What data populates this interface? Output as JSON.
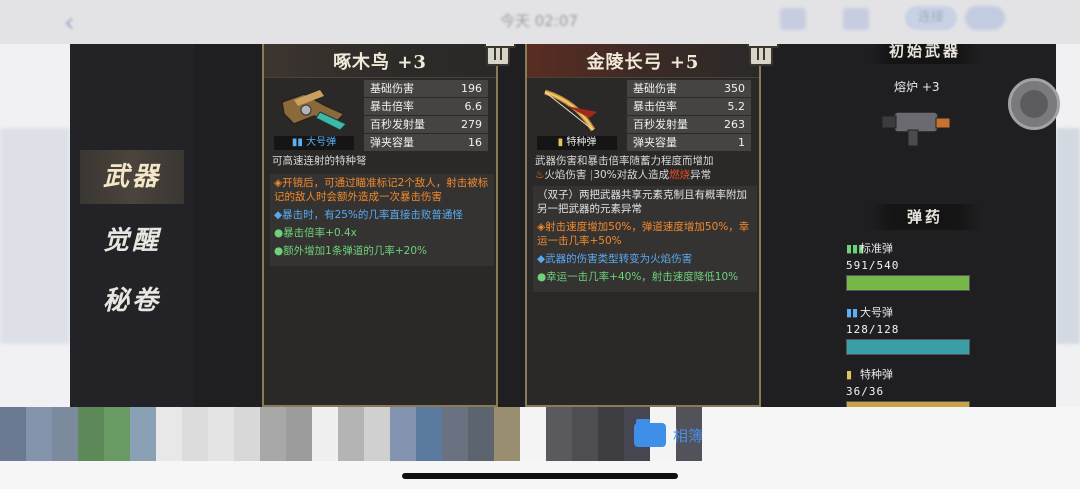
{
  "topbar": {
    "date": "今天 02:07",
    "chip_label": "连接"
  },
  "nav": {
    "items": [
      {
        "label": "武器",
        "active": true
      },
      {
        "label": "觉醒",
        "active": false
      },
      {
        "label": "秘卷",
        "active": false
      }
    ]
  },
  "weapons": [
    {
      "name": "啄木鸟 +3",
      "ammo_type": "大号弹",
      "ammo_color": "#5ab0f0",
      "stats": [
        {
          "label": "基础伤害",
          "value": "196"
        },
        {
          "label": "暴击倍率",
          "value": "6.6"
        },
        {
          "label": "百秒发射量",
          "value": "279"
        },
        {
          "label": "弹夹容量",
          "value": "16"
        }
      ],
      "description": "可高速连射的特种弩",
      "effects": [
        {
          "text": "◈开镜后，可通过瞄准标记2个敌人，射击被标记的敌人时会额外造成一次暴击伤害",
          "color": "orange"
        },
        {
          "text": "◆暴击时，有25%的几率直接击败普通怪",
          "color": "blue"
        },
        {
          "text": "●暴击倍率+0.4x",
          "color": "green"
        },
        {
          "text": "●额外增加1条弹道的几率+20%",
          "color": "green"
        }
      ]
    },
    {
      "name": "金陵长弓 +5",
      "ammo_type": "特种弹",
      "ammo_color": "#e8c060",
      "stats": [
        {
          "label": "基础伤害",
          "value": "350"
        },
        {
          "label": "暴击倍率",
          "value": "5.2"
        },
        {
          "label": "百秒发射量",
          "value": "263"
        },
        {
          "label": "弹夹容量",
          "value": "1"
        }
      ],
      "description": "武器伤害和暴击倍率随蓄力程度而增加",
      "element_label": "火焰伤害",
      "element_desc": "30%对敌人造成",
      "element_status": "燃烧",
      "element_suffix": "异常",
      "effects": [
        {
          "text": "（双子）两把武器共享元素克制且有概率附加另一把武器的元素异常",
          "color": "grey"
        },
        {
          "text": "◈射击速度增加50%，弹道速度增加50%，幸运一击几率+50%",
          "color": "orange"
        },
        {
          "text": "◆武器的伤害类型转变为火焰伤害",
          "color": "blue"
        },
        {
          "text": "●幸运一击几率+40%，射击速度降低10%",
          "color": "green"
        }
      ]
    }
  ],
  "initial_weapon": {
    "header": "初始武器",
    "name": "熔炉 +3"
  },
  "ammo": {
    "header": "弹药",
    "items": [
      {
        "label": "标准弹",
        "count": "591/540",
        "fill": 1.0,
        "color": "#76b84a",
        "icon_color": "#6fd17a"
      },
      {
        "label": "大号弹",
        "count": "128/128",
        "fill": 1.0,
        "color": "#3aa0a8",
        "icon_color": "#5ab0f0"
      },
      {
        "label": "特种弹",
        "count": "36/36",
        "fill": 1.0,
        "color": "#c9a24a",
        "icon_color": "#e8c060"
      }
    ]
  },
  "strip": {
    "album_label": "相簿"
  }
}
